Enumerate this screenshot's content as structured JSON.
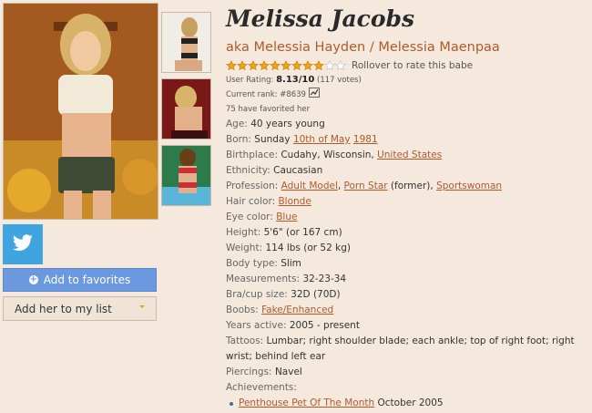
{
  "profile": {
    "name": "Melissa Jacobs",
    "aka": "aka Melessia Hayden / Melessia Maenpaa",
    "rating_hint": "Rollover to rate this babe",
    "stars": {
      "filled": 9,
      "total": 11
    },
    "user_rating_label": "User Rating:",
    "user_rating_value": "8.13/10",
    "user_rating_votes": "(117 votes)",
    "current_rank": "Current rank: #8639",
    "favorited": "75 have favorited her"
  },
  "details": {
    "age_label": "Age:",
    "age_value": "40 years young",
    "born_label": "Born:",
    "born_weekday": "Sunday",
    "born_date_link": "10th of May",
    "born_year_link": "1981",
    "birthplace_label": "Birthplace:",
    "birthplace_value": "Cudahy, Wisconsin,",
    "birthplace_link": "United States",
    "ethnicity_label": "Ethnicity:",
    "ethnicity_value": "Caucasian",
    "profession_label": "Profession:",
    "profession_link1": "Adult Model",
    "profession_sep1": ",",
    "profession_link2": "Porn Star",
    "profession_note": "(former),",
    "profession_link3": "Sportswoman",
    "hair_label": "Hair color:",
    "hair_link": "Blonde",
    "eye_label": "Eye color:",
    "eye_link": "Blue",
    "height_label": "Height:",
    "height_value": "5'6\" (or 167 cm)",
    "weight_label": "Weight:",
    "weight_value": "114 lbs (or 52 kg)",
    "body_label": "Body type:",
    "body_value": "Slim",
    "measurements_label": "Measurements:",
    "measurements_value": "32-23-34",
    "bra_label": "Bra/cup size:",
    "bra_value": "32D (70D)",
    "boobs_label": "Boobs:",
    "boobs_link": "Fake/Enhanced",
    "years_label": "Years active:",
    "years_value": "2005 - present",
    "tattoos_label": "Tattoos:",
    "tattoos_value": "Lumbar; right shoulder blade; each ankle; top of right foot; right wrist; behind left ear",
    "piercings_label": "Piercings:",
    "piercings_value": "Navel",
    "achievements_label": "Achievements:",
    "achievement_link": "Penthouse Pet Of The Month",
    "achievement_date": "October 2005"
  },
  "sidebar": {
    "add_favorites": "Add to favorites",
    "add_list": "Add her to my list"
  },
  "colors": {
    "background": "#f5e9dd",
    "link": "#b05a2c",
    "twitter": "#3fa4e0",
    "favorites_button": "#6b99e0",
    "star": "#f0a020"
  },
  "icons": {
    "twitter": "twitter-bird-icon",
    "plus": "plus-circle-icon",
    "caret": "caret-down-icon",
    "chart": "chart-icon"
  }
}
